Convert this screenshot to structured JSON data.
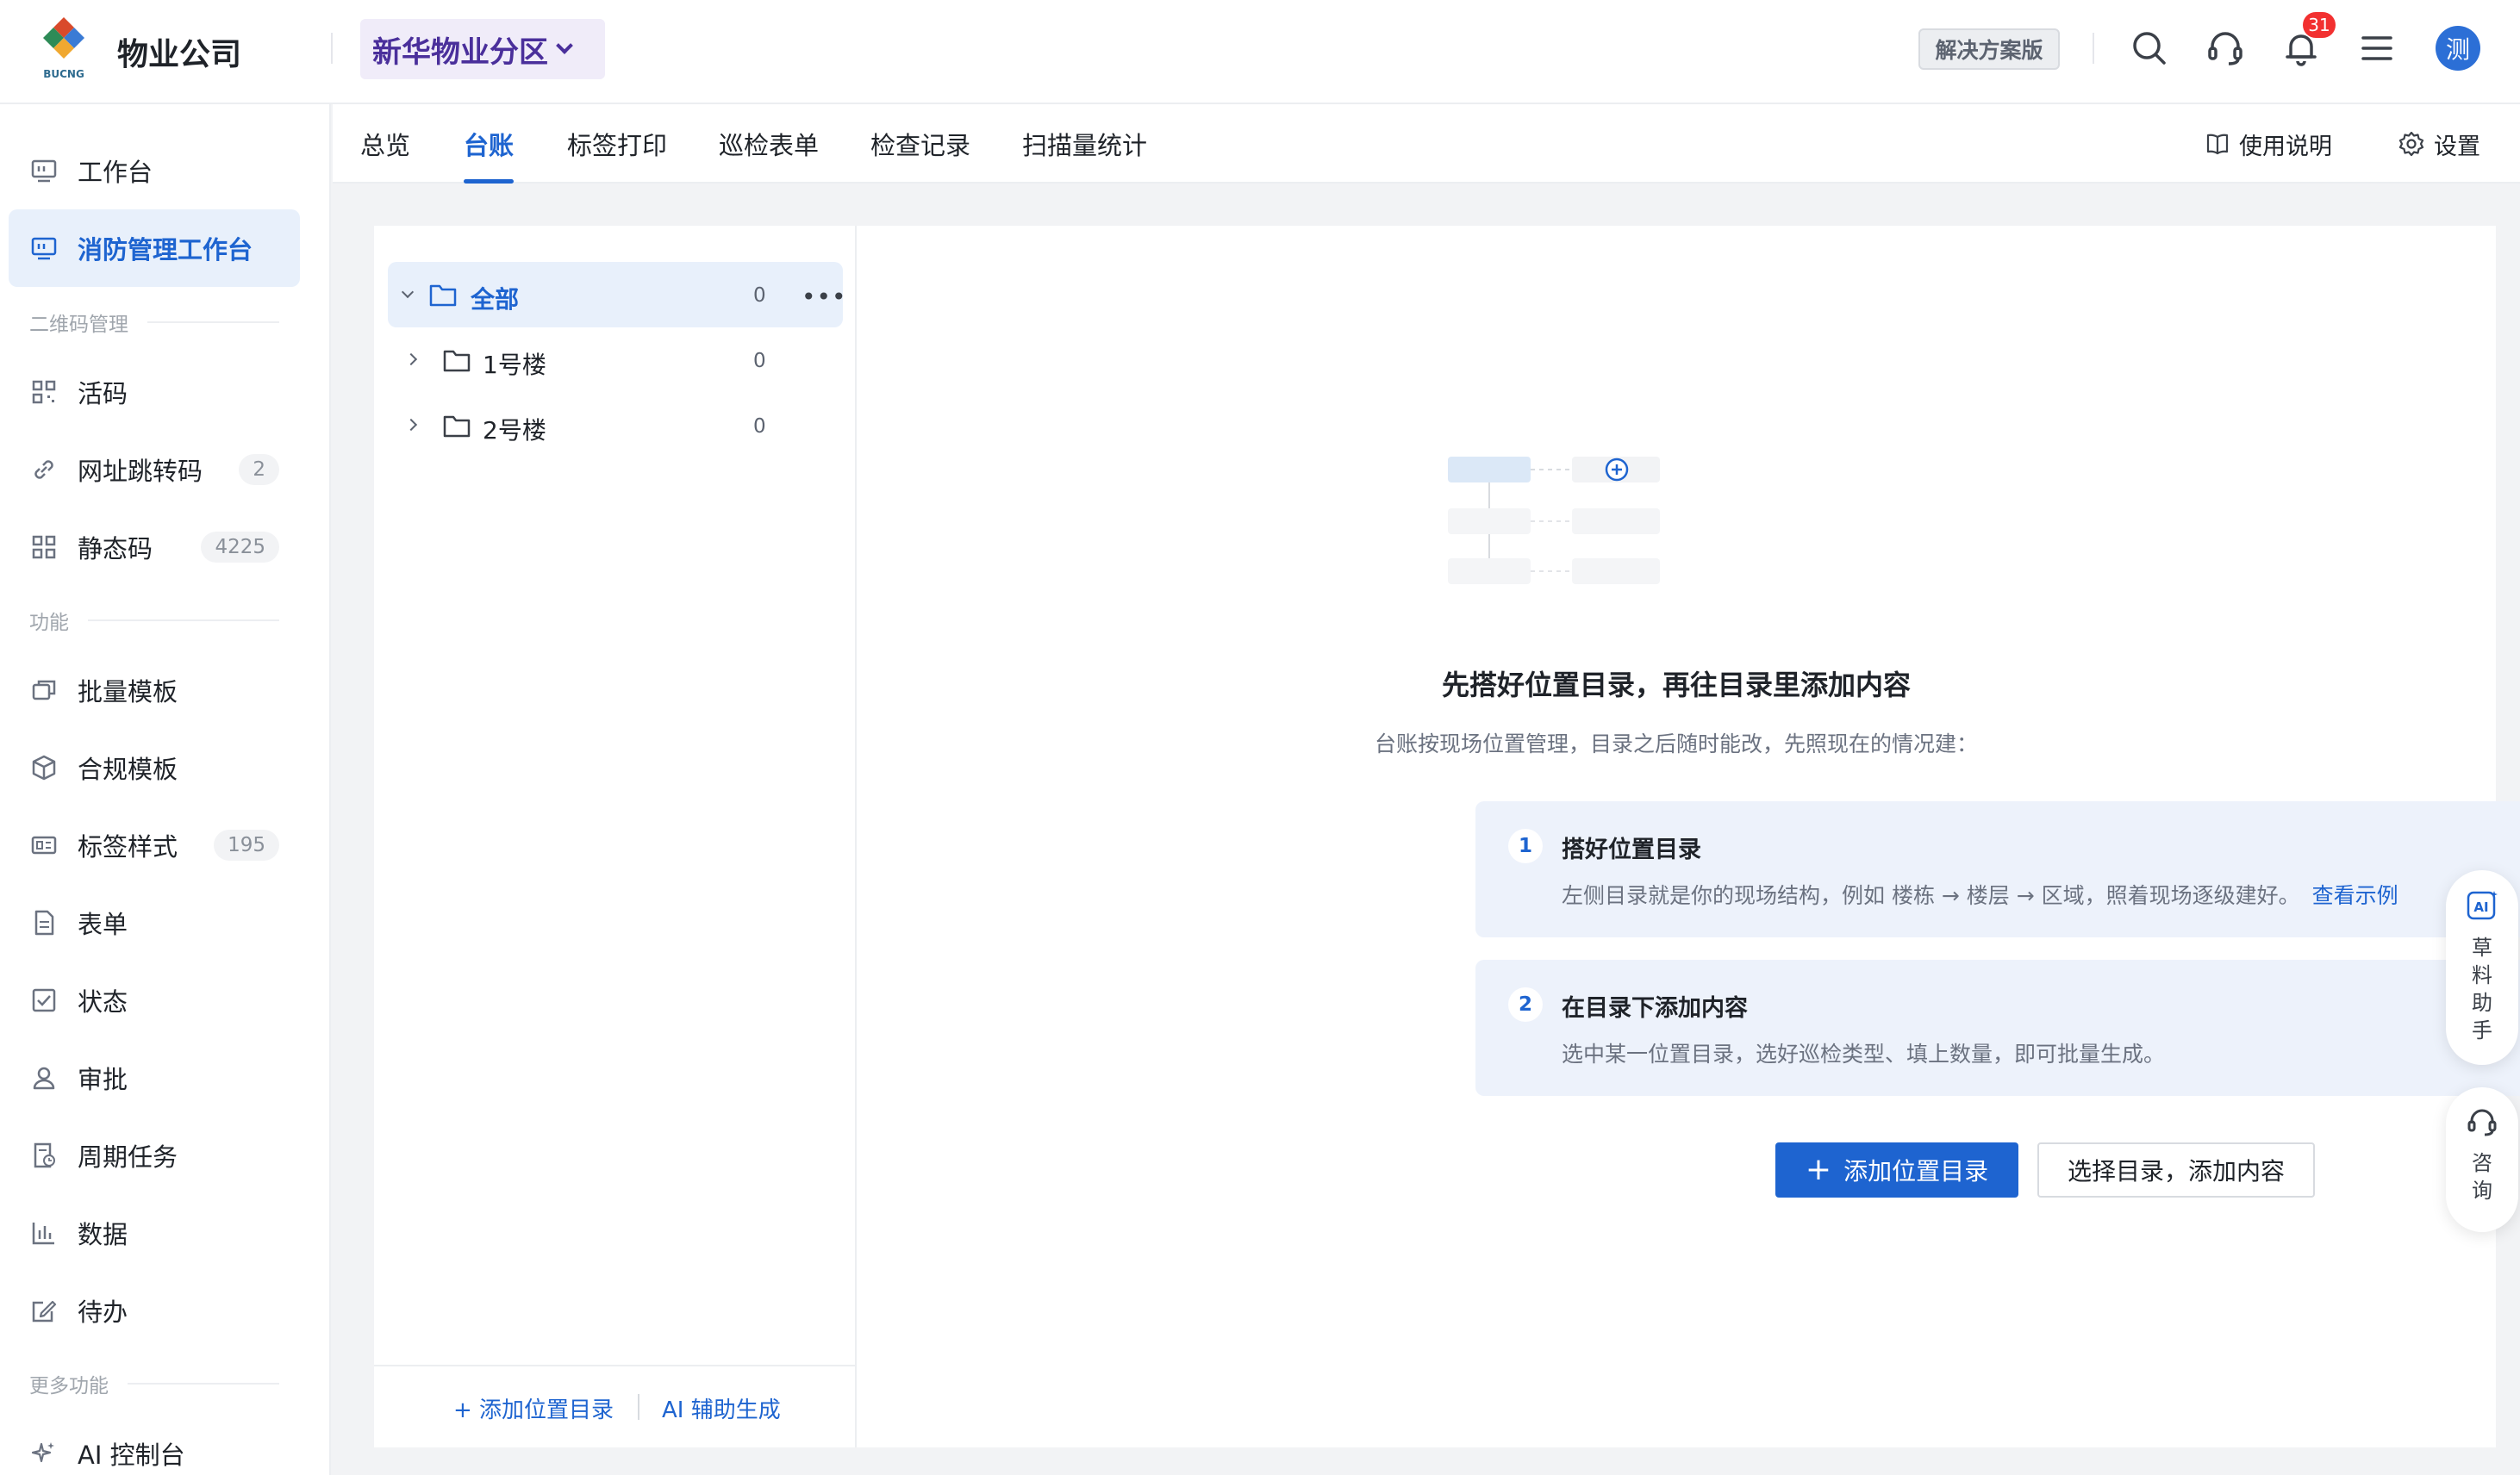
{
  "header": {
    "logo_text": "BUCNG",
    "brand": "物业公司",
    "org_selector": "新华物业分区",
    "edition": "解决方案版",
    "notification_count": "31",
    "avatar_initial": "测",
    "icons": [
      "search-icon",
      "headset-icon",
      "bell-icon",
      "menu-icon"
    ]
  },
  "sidebar": {
    "items_top": [
      {
        "label": "工作台",
        "icon": "monitor-icon"
      },
      {
        "label": "消防管理工作台",
        "icon": "monitor-icon",
        "active": true
      }
    ],
    "group_qr": "二维码管理",
    "items_qr": [
      {
        "label": "活码",
        "icon": "qrcode-icon",
        "count": ""
      },
      {
        "label": "网址跳转码",
        "icon": "link-icon",
        "count": "2"
      },
      {
        "label": "静态码",
        "icon": "grid-code-icon",
        "count": "4225"
      }
    ],
    "group_func": "功能",
    "items_func": [
      {
        "label": "批量模板",
        "icon": "copy-icon",
        "count": ""
      },
      {
        "label": "合规模板",
        "icon": "cube-icon",
        "count": ""
      },
      {
        "label": "标签样式",
        "icon": "label-icon",
        "count": "195"
      },
      {
        "label": "表单",
        "icon": "document-icon",
        "count": ""
      },
      {
        "label": "状态",
        "icon": "checkbox-icon",
        "count": ""
      },
      {
        "label": "审批",
        "icon": "person-icon",
        "count": ""
      },
      {
        "label": "周期任务",
        "icon": "calendar-doc-icon",
        "count": ""
      },
      {
        "label": "数据",
        "icon": "bar-chart-icon",
        "count": ""
      },
      {
        "label": "待办",
        "icon": "edit-icon",
        "count": ""
      }
    ],
    "group_more": "更多功能",
    "items_more": [
      {
        "label": "AI 控制台",
        "icon": "sparkle-icon"
      }
    ]
  },
  "tabs": {
    "items": [
      "总览",
      "台账",
      "标签打印",
      "巡检表单",
      "检查记录",
      "扫描量统计"
    ],
    "active": "台账",
    "help": "使用说明",
    "settings": "设置"
  },
  "tree": {
    "root": {
      "label": "全部",
      "count": "0"
    },
    "children": [
      {
        "label": "1号楼",
        "count": "0"
      },
      {
        "label": "2号楼",
        "count": "0"
      }
    ],
    "footer_add": "+ 添加位置目录",
    "footer_ai": "AI 辅助生成"
  },
  "empty_state": {
    "title": "先搭好位置目录，再往目录里添加内容",
    "subtitle": "台账按现场位置管理，目录之后随时能改，先照现在的情况建：",
    "steps": [
      {
        "num": "1",
        "title": "搭好位置目录",
        "desc": "左侧目录就是你的现场结构，例如 楼栋 → 楼层 → 区域，照着现场逐级建好。",
        "link": "查看示例"
      },
      {
        "num": "2",
        "title": "在目录下添加内容",
        "desc": "选中某一位置目录，选好巡检类型、填上数量，即可批量生成。",
        "link": ""
      }
    ],
    "primary_button": "添加位置目录",
    "primary_plus": "+",
    "secondary_button": "选择目录，添加内容"
  },
  "floating": {
    "assistant": "草料助手",
    "assistant_chars": [
      "草",
      "料",
      "助",
      "手"
    ],
    "consult_chars": [
      "咨",
      "询"
    ]
  },
  "colors": {
    "accent": "#1e64d0",
    "brand_purple": "#4a2f9b",
    "badge_red": "#f23030",
    "active_bg": "#e8f0fb",
    "step_bg": "#edf2fb"
  }
}
